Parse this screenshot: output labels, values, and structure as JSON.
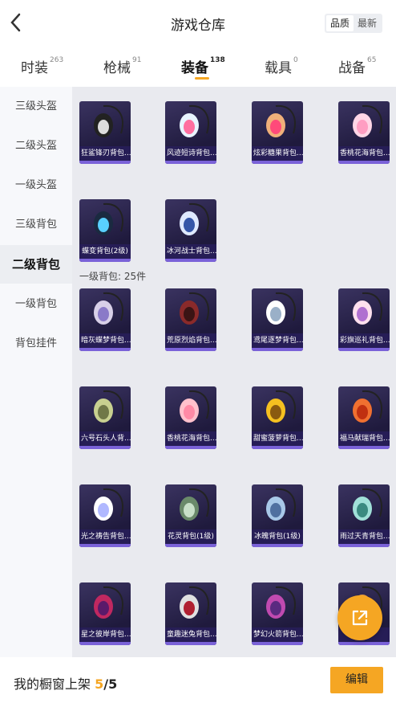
{
  "header": {
    "title": "游戏仓库",
    "sort_quality": "品质",
    "sort_latest": "最新"
  },
  "tabs": [
    {
      "label": "时装",
      "count": "263"
    },
    {
      "label": "枪械",
      "count": "91"
    },
    {
      "label": "装备",
      "count": "138"
    },
    {
      "label": "载具",
      "count": "0"
    },
    {
      "label": "战备",
      "count": "65"
    }
  ],
  "sidebar": {
    "items": [
      {
        "label": "三级头盔"
      },
      {
        "label": "二级头盔"
      },
      {
        "label": "一级头盔"
      },
      {
        "label": "三级背包"
      },
      {
        "label": "二级背包"
      },
      {
        "label": "一级背包"
      },
      {
        "label": "背包挂件"
      }
    ]
  },
  "section": {
    "level1_label": "一级背包: 25件"
  },
  "items_level2": [
    {
      "name": "狂鲨锋刃背包...",
      "icon": "shark-backpack-icon"
    },
    {
      "name": "风迹短诗背包...",
      "icon": "poem-backpack-icon"
    },
    {
      "name": "炫彩糖果背包...",
      "icon": "candy-backpack-icon"
    },
    {
      "name": "香桃花海背包...",
      "icon": "peach-backpack-icon"
    },
    {
      "name": "蝶变背包(2级)",
      "icon": "butterfly-backpack-icon"
    },
    {
      "name": "冰河战士背包...",
      "icon": "glacier-backpack-icon"
    }
  ],
  "items_level1": [
    {
      "name": "暗灰蝶梦背包...",
      "icon": "grey-butterfly-backpack-icon"
    },
    {
      "name": "荒原烈焰背包...",
      "icon": "wasteland-flame-backpack-icon"
    },
    {
      "name": "鸢尾逐梦背包...",
      "icon": "iris-backpack-icon"
    },
    {
      "name": "彩旗巡礼背包...",
      "icon": "flag-backpack-icon"
    },
    {
      "name": "六号石头人背...",
      "icon": "stone-man-backpack-icon"
    },
    {
      "name": "香桃花海背包...",
      "icon": "peach-backpack-icon"
    },
    {
      "name": "甜蜜菠萝背包...",
      "icon": "pineapple-backpack-icon"
    },
    {
      "name": "福马献瑞背包...",
      "icon": "lucky-horse-backpack-icon"
    },
    {
      "name": "光之祷告背包...",
      "icon": "light-prayer-backpack-icon"
    },
    {
      "name": "花灵背包(1级)",
      "icon": "flower-spirit-backpack-icon"
    },
    {
      "name": "冰魄背包(1级)",
      "icon": "ice-soul-backpack-icon"
    },
    {
      "name": "雨过天青背包...",
      "icon": "rain-sky-backpack-icon"
    },
    {
      "name": "星之彼岸背包...",
      "icon": "star-shore-backpack-icon"
    },
    {
      "name": "童趣迷兔背包...",
      "icon": "bunny-backpack-icon"
    },
    {
      "name": "梦幻火箭背包...",
      "icon": "rocket-backpack-icon"
    },
    {
      "name": "...",
      "icon": "backpack-icon"
    }
  ],
  "bottom": {
    "text": "我的橱窗上架",
    "count": "5",
    "separator": "/",
    "total": "5",
    "edit_label": "编辑"
  },
  "colors": {
    "accent": "#f5a623",
    "card_bg": "#2a2350",
    "card_bar": "#7a62d8"
  }
}
